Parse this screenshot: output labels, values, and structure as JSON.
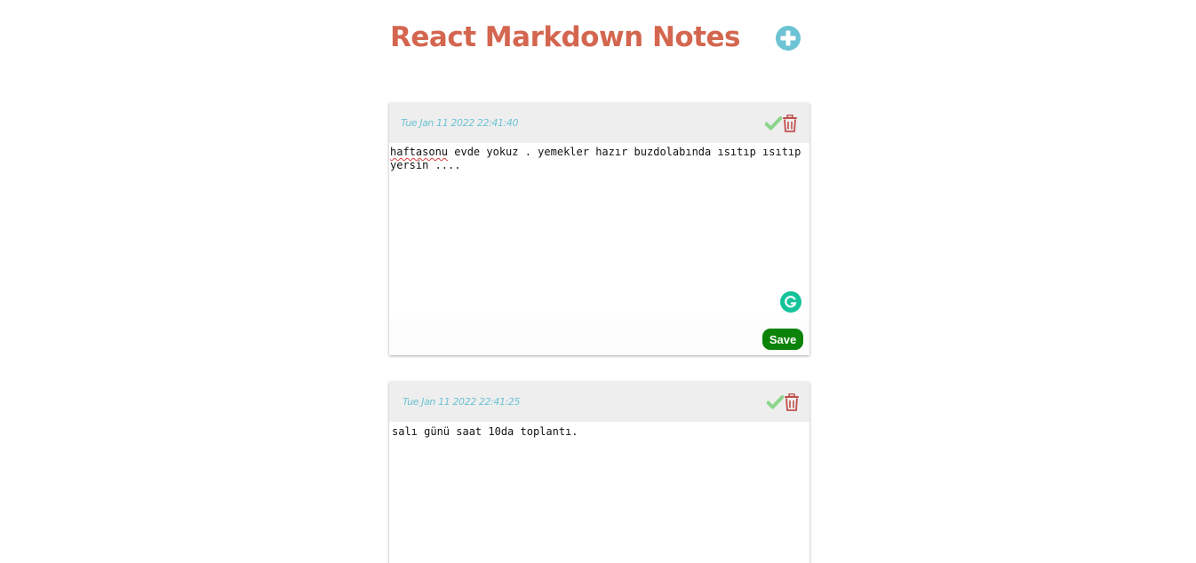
{
  "app": {
    "title": "React Markdown Notes"
  },
  "colors": {
    "title": "#d4664f",
    "add_button": "#6cc3d4",
    "date": "#6cc3d4",
    "check": "#8bd58b",
    "trash": "#c0504d",
    "save": "#0b8308",
    "grammarly": "#15c39a"
  },
  "icons": {
    "add": "plus-circle-icon",
    "done": "checkmark-icon",
    "delete": "trash-icon",
    "assistant": "grammarly-icon"
  },
  "notes": [
    {
      "date": "Tue Jan 11 2022 22:41:40",
      "first_word": "haftasonu",
      "rest": " evde yokuz . yemekler hazır buzdolabında ısıtıp ısıtıp yersin ....",
      "save_label": "Save"
    },
    {
      "date": "Tue Jan 11 2022 22:41:25",
      "text": "salı günü saat 10da toplantı."
    }
  ]
}
